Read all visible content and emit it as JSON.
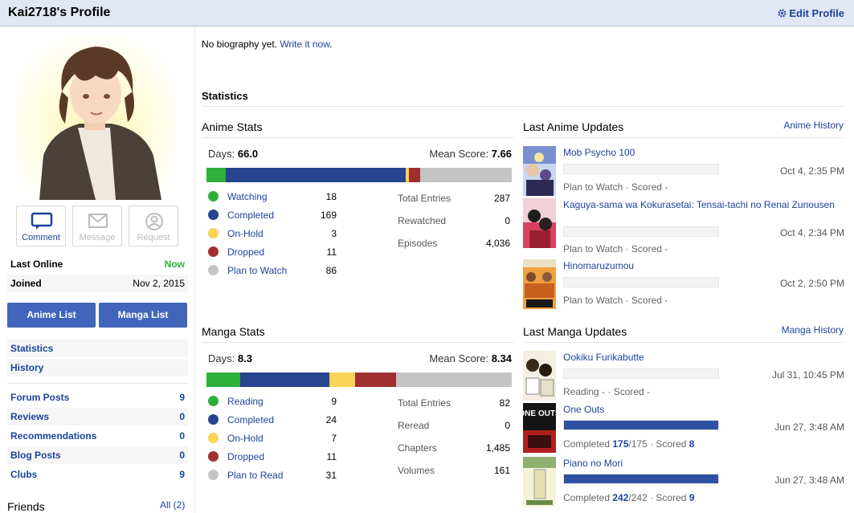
{
  "header": {
    "title": "Kai2718's Profile",
    "edit_label": "Edit Profile"
  },
  "actions": {
    "comment": "Comment",
    "message": "Message",
    "request": "Request"
  },
  "info": {
    "last_online_label": "Last Online",
    "last_online_value": "Now",
    "joined_label": "Joined",
    "joined_value": "Nov 2, 2015"
  },
  "lists": {
    "anime": "Anime List",
    "manga": "Manga List"
  },
  "nav": {
    "statistics": "Statistics",
    "history": "History"
  },
  "counts": [
    {
      "label": "Forum Posts",
      "value": "9"
    },
    {
      "label": "Reviews",
      "value": "0"
    },
    {
      "label": "Recommendations",
      "value": "0"
    },
    {
      "label": "Blog Posts",
      "value": "0"
    },
    {
      "label": "Clubs",
      "value": "9"
    }
  ],
  "friends": {
    "label": "Friends",
    "all": "All (2)"
  },
  "bio": {
    "text": "No biography yet.",
    "link": "Write it now"
  },
  "statistics_heading": "Statistics",
  "colors": {
    "watching": "#2db039",
    "completed": "#26448f",
    "onhold": "#f9d457",
    "dropped": "#a12f31",
    "plan": "#c4c4c4"
  },
  "anime_stats": {
    "title": "Anime Stats",
    "days_label": "Days:",
    "days": "66.0",
    "mean_label": "Mean Score:",
    "mean": "7.66",
    "legend": [
      {
        "label": "Watching",
        "value": "18"
      },
      {
        "label": "Completed",
        "value": "169"
      },
      {
        "label": "On-Hold",
        "value": "3"
      },
      {
        "label": "Dropped",
        "value": "11"
      },
      {
        "label": "Plan to Watch",
        "value": "86"
      }
    ],
    "totals": [
      {
        "label": "Total Entries",
        "value": "287"
      },
      {
        "label": "Rewatched",
        "value": "0"
      },
      {
        "label": "Episodes",
        "value": "4,036"
      }
    ]
  },
  "manga_stats": {
    "title": "Manga Stats",
    "days_label": "Days:",
    "days": "8.3",
    "mean_label": "Mean Score:",
    "mean": "8.34",
    "legend": [
      {
        "label": "Reading",
        "value": "9"
      },
      {
        "label": "Completed",
        "value": "24"
      },
      {
        "label": "On-Hold",
        "value": "7"
      },
      {
        "label": "Dropped",
        "value": "11"
      },
      {
        "label": "Plan to Read",
        "value": "31"
      }
    ],
    "totals": [
      {
        "label": "Total Entries",
        "value": "82"
      },
      {
        "label": "Reread",
        "value": "0"
      },
      {
        "label": "Chapters",
        "value": "1,485"
      },
      {
        "label": "Volumes",
        "value": "161"
      }
    ]
  },
  "anime_updates": {
    "title": "Last Anime Updates",
    "link": "Anime History",
    "items": [
      {
        "name": "Mob Psycho 100",
        "date": "Oct 4, 2:35 PM",
        "status": "Plan to Watch · Scored -",
        "progress": 0
      },
      {
        "name": "Kaguya-sama wa Kokurasetai: Tensai-tachi no Renai Zunousen",
        "date": "Oct 4, 2:34 PM",
        "status": "Plan to Watch · Scored -",
        "progress": 0
      },
      {
        "name": "Hinomaruzumou",
        "date": "Oct 2, 2:50 PM",
        "status": "Plan to Watch · Scored -",
        "progress": 0
      }
    ]
  },
  "manga_updates": {
    "title": "Last Manga Updates",
    "link": "Manga History",
    "items": [
      {
        "name": "Ookiku Furikabutte",
        "date": "Jul 31, 10:45 PM",
        "status_pre": "Reading - · Scored -",
        "progress": 0
      },
      {
        "name": "One Outs",
        "date": "Jun 27, 3:48 AM",
        "status_pre": "Completed",
        "count": "175",
        "total": "/175 · Scored",
        "score": "8",
        "progress": 1
      },
      {
        "name": "Piano no Mori",
        "date": "Jun 27, 3:48 AM",
        "status_pre": "Completed",
        "count": "242",
        "total": "/242 · Scored",
        "score": "9",
        "progress": 1
      }
    ]
  },
  "cover_text": {
    "one_outs": "ONE OUTS"
  }
}
